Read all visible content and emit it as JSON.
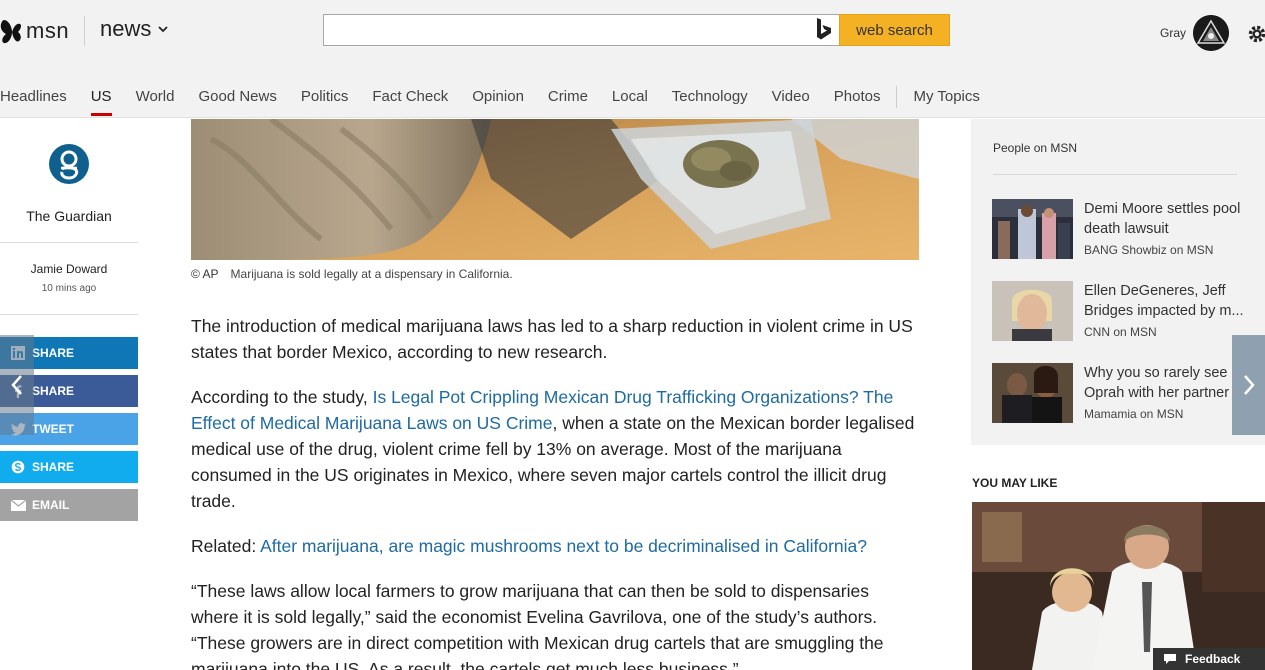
{
  "brand": {
    "logo_text": "msn",
    "vertical": "news"
  },
  "search": {
    "placeholder": "",
    "value": "",
    "button_label": "web search"
  },
  "user": {
    "name": "Gray"
  },
  "nav": {
    "items": [
      {
        "label": "Headlines"
      },
      {
        "label": "US",
        "active": true
      },
      {
        "label": "World"
      },
      {
        "label": "Good News"
      },
      {
        "label": "Politics"
      },
      {
        "label": "Fact Check"
      },
      {
        "label": "Opinion"
      },
      {
        "label": "Crime"
      },
      {
        "label": "Local"
      },
      {
        "label": "Technology"
      },
      {
        "label": "Video"
      },
      {
        "label": "Photos"
      }
    ],
    "my_topics": "My Topics"
  },
  "publisher": {
    "name": "The Guardian",
    "author": "Jamie Doward",
    "time": "10 mins ago"
  },
  "share": [
    {
      "label": "SHARE",
      "network": "linkedin-icon",
      "color": "#0f77b5"
    },
    {
      "label": "SHARE",
      "network": "facebook-icon",
      "color": "#3b5b98"
    },
    {
      "label": "TWEET",
      "network": "twitter-icon",
      "color": "#4aa3e6"
    },
    {
      "label": "SHARE",
      "network": "skype-icon",
      "color": "#11aced"
    },
    {
      "label": "EMAIL",
      "network": "email-icon",
      "color": "#a3a3a3"
    }
  ],
  "article": {
    "image_credit": "© AP",
    "image_caption": "Marijuana is sold legally at a dispensary in California.",
    "p1": "The introduction of medical marijuana laws has led to a sharp reduction in violent crime in US states that border Mexico, according to new research.",
    "p2_before": "According to the study, ",
    "p2_link": "Is Legal Pot Crippling Mexican Drug Trafficking Organizations? The Effect of Medical Marijuana Laws on US Crime",
    "p2_after": ", when a state on the Mexican border legalised medical use of the drug, violent crime fell by 13% on average. Most of the marijuana consumed in the US originates in Mexico, where seven major cartels control the illicit drug trade.",
    "related_label": "Related: ",
    "related_link": "After marijuana, are magic mushrooms next to be decriminalised in California?",
    "p4": "“These laws allow local farmers to grow marijuana that can then be sold to dispensaries where it is sold legally,” said the economist Evelina Gavrilova, one of the study’s authors. “These growers are in direct competition with Mexican drug cartels that are smuggling the marijuana into the US. As a result, the cartels get much less business.”"
  },
  "rail": {
    "title": "People on MSN",
    "items": [
      {
        "title_line1": "Demi Moore settles pool",
        "title_line2": "death lawsuit",
        "source": "BANG Showbiz on MSN"
      },
      {
        "title_line1": "Ellen DeGeneres, Jeff",
        "title_line2": "Bridges impacted by m...",
        "source": "CNN on MSN"
      },
      {
        "title_line1": "Why you so rarely see",
        "title_line2": "Oprah with her partner ...",
        "source": "Mamamia on MSN"
      }
    ]
  },
  "you_may_like": {
    "title": "YOU MAY LIKE"
  },
  "feedback": {
    "label": "Feedback"
  },
  "colors": {
    "accent_active_tab": "#cc0000",
    "link": "#1e6aa3",
    "search_button": "#f4b124"
  }
}
